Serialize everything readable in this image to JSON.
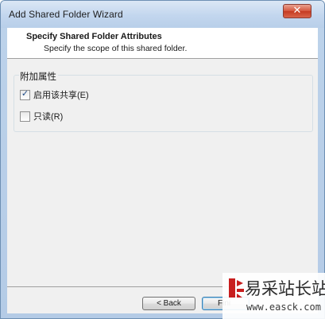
{
  "window": {
    "title": "Add Shared Folder Wizard",
    "close_glyph": "✕"
  },
  "header": {
    "title": "Specify Shared Folder Attributes",
    "subtitle": "Specify the scope of this shared folder."
  },
  "attributes_group": {
    "label": "附加属性",
    "options": [
      {
        "label": "启用该共享(E)",
        "checked": true
      },
      {
        "label": "只读(R)",
        "checked": false
      }
    ]
  },
  "footer": {
    "back_label": "< Back",
    "finish_label": "Fini"
  },
  "watermark": {
    "brand": "易采站长站",
    "url": "www.easck.com"
  },
  "colors": {
    "title_bar": "#c2d6ee",
    "close_button": "#d4563d",
    "checkmark": "#1d4a86",
    "finish_border": "#3c7fb1"
  }
}
